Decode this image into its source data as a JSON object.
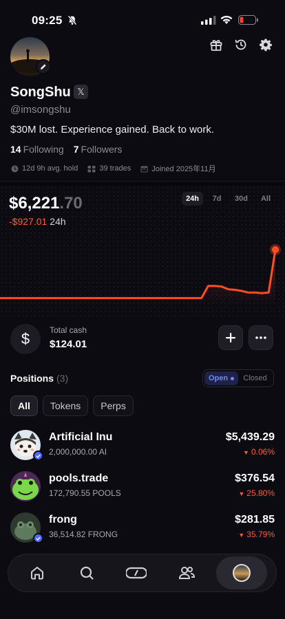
{
  "status_bar": {
    "time": "09:25"
  },
  "profile": {
    "name": "SongShu",
    "x_badge": "𝕏",
    "handle": "@imsongshu",
    "bio": "$30M lost. Experience gained. Back to work.",
    "following_count": "14",
    "following_label": "Following",
    "followers_count": "7",
    "followers_label": "Followers",
    "avg_hold": "12d 9h avg. hold",
    "trades": "39 trades",
    "joined": "Joined 2025年11月"
  },
  "portfolio": {
    "value_whole": "$6,221",
    "value_cents": ".70",
    "change": "-$927.01",
    "period": "24h",
    "timeframes": [
      "24h",
      "7d",
      "30d",
      "All"
    ],
    "active_timeframe": "24h"
  },
  "chart_data": {
    "type": "line",
    "series": [
      {
        "values": [
          0.02,
          0.02,
          0.02,
          0.02,
          0.02,
          0.02,
          0.02,
          0.02,
          0.02,
          0.02,
          0.02,
          0.02,
          0.02,
          0.02,
          0.02,
          0.02,
          0.02,
          0.02,
          0.02,
          0.02,
          0.02,
          0.02,
          0.02,
          0.02,
          0.02,
          0.02,
          0.02,
          0.02,
          0.02,
          0.02,
          0.02,
          0.24,
          0.24,
          0.23,
          0.18,
          0.17,
          0.15,
          0.12,
          0.12,
          0.11,
          0.12,
          0.9
        ]
      }
    ],
    "color": "#ff4d24"
  },
  "cash": {
    "label": "Total cash",
    "value": "$124.01"
  },
  "positions": {
    "title": "Positions",
    "count": "(3)",
    "toggle_open": "Open",
    "toggle_closed": "Closed",
    "filters": [
      "All",
      "Tokens",
      "Perps"
    ],
    "items": [
      {
        "name": "Artificial Inu",
        "amount": "2,000,000.00 AI",
        "value": "$5,439.29",
        "change": "0.06%"
      },
      {
        "name": "pools.trade",
        "amount": "172,790.55 POOLS",
        "value": "$376.54",
        "change": "25.80%"
      },
      {
        "name": "frong",
        "amount": "36,514.82 FRONG",
        "value": "$281.85",
        "change": "35.79%"
      }
    ]
  },
  "colors": {
    "accent": "#6f86ff",
    "negative": "#ff5a36",
    "background": "#0c0b12"
  }
}
